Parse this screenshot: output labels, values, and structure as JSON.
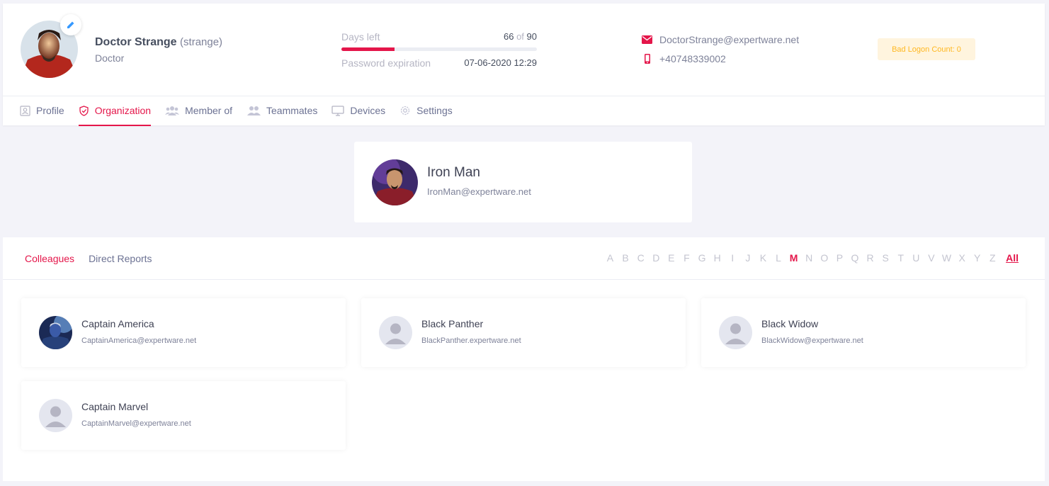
{
  "user": {
    "name": "Doctor Strange",
    "login": "(strange)",
    "role": "Doctor"
  },
  "password_status": {
    "days_left_label": "Days left",
    "days_left": "66",
    "of_label": "of",
    "days_total": "90",
    "days_progress_fraction": 0.27,
    "expiration_label": "Password expiration",
    "expiration_value": "07-06-2020 12:29"
  },
  "contact": {
    "email": "DoctorStrange@expertware.net",
    "phone": "+40748339002"
  },
  "bad_logon": "Bad Logon Count: 0",
  "tabs": [
    {
      "label": "Profile",
      "icon": "profile-icon"
    },
    {
      "label": "Organization",
      "icon": "shield-icon"
    },
    {
      "label": "Member of",
      "icon": "group-icon"
    },
    {
      "label": "Teammates",
      "icon": "users-icon"
    },
    {
      "label": "Devices",
      "icon": "monitor-icon"
    },
    {
      "label": "Settings",
      "icon": "gear-icon"
    }
  ],
  "manager": {
    "name": "Iron Man",
    "email": "IronMan@expertware.net"
  },
  "subtabs": [
    "Colleagues",
    "Direct Reports"
  ],
  "letters": [
    "A",
    "B",
    "C",
    "D",
    "E",
    "F",
    "G",
    "H",
    "I",
    "J",
    "K",
    "L",
    "M",
    "N",
    "O",
    "P",
    "Q",
    "R",
    "S",
    "T",
    "U",
    "V",
    "W",
    "X",
    "Y",
    "Z"
  ],
  "all_label": "All",
  "colleagues": [
    {
      "name": "Captain America",
      "email": "CaptainAmerica@expertware.net"
    },
    {
      "name": "Black Panther",
      "email": "BlackPanther.expertware.net"
    },
    {
      "name": "Black Widow",
      "email": "BlackWidow@expertware.net"
    },
    {
      "name": "Captain Marvel",
      "email": "CaptainMarvel@expertware.net"
    }
  ],
  "colors": {
    "accent": "#e4164a",
    "warning_bg": "#fff4de",
    "warning_text": "#ffb822"
  }
}
